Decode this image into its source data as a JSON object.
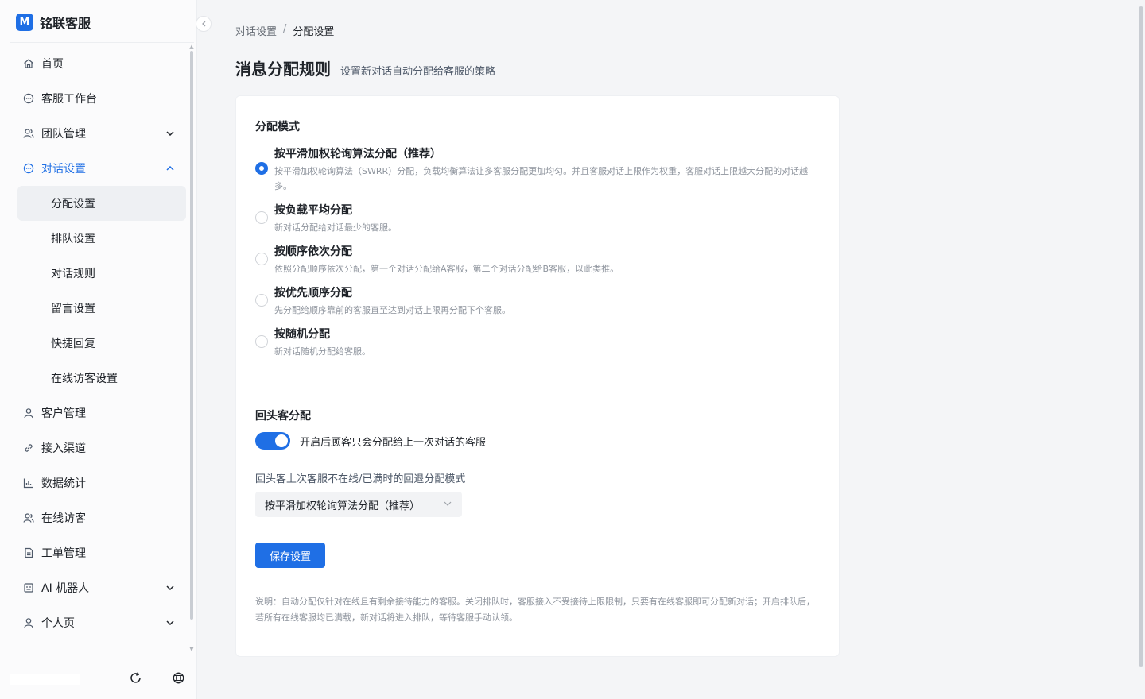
{
  "brand": {
    "logo_letter": "M",
    "name": "铭联客服"
  },
  "sidebar": {
    "items": [
      {
        "label": "首页",
        "icon": "home-icon"
      },
      {
        "label": "客服工作台",
        "icon": "chat-bubble-icon"
      },
      {
        "label": "团队管理",
        "icon": "team-icon",
        "has_children": true,
        "expanded": false
      },
      {
        "label": "对话设置",
        "icon": "chat-bubble-icon",
        "has_children": true,
        "expanded": true,
        "children": [
          "分配设置",
          "排队设置",
          "对话规则",
          "留言设置",
          "快捷回复",
          "在线访客设置"
        ],
        "active_child": "分配设置"
      },
      {
        "label": "客户管理",
        "icon": "user-icon"
      },
      {
        "label": "接入渠道",
        "icon": "link-icon"
      },
      {
        "label": "数据统计",
        "icon": "bar-chart-icon"
      },
      {
        "label": "在线访客",
        "icon": "visitors-icon"
      },
      {
        "label": "工单管理",
        "icon": "ticket-icon"
      },
      {
        "label": "AI 机器人",
        "icon": "robot-icon",
        "has_children": true,
        "expanded": false
      },
      {
        "label": "个人页",
        "icon": "user-icon",
        "has_children": true,
        "expanded": false
      }
    ]
  },
  "breadcrumb": {
    "parent": "对话设置",
    "separator": "/",
    "current": "分配设置"
  },
  "page": {
    "title": "消息分配规则",
    "subtitle": "设置新对话自动分配给客服的策略"
  },
  "assign_mode": {
    "section_title": "分配模式",
    "options": [
      {
        "title": "按平滑加权轮询算法分配（推荐）",
        "desc": "按平滑加权轮询算法（SWRR）分配，负载均衡算法让多客服分配更加均匀。并且客服对话上限作为权重，客服对话上限越大分配的对话越多。",
        "checked": true
      },
      {
        "title": "按负载平均分配",
        "desc": "新对话分配给对话最少的客服。",
        "checked": false
      },
      {
        "title": "按顺序依次分配",
        "desc": "依照分配顺序依次分配，第一个对话分配给A客服，第二个对话分配给B客服，以此类推。",
        "checked": false
      },
      {
        "title": "按优先顺序分配",
        "desc": "先分配给顺序靠前的客服直至达到对话上限再分配下个客服。",
        "checked": false
      },
      {
        "title": "按随机分配",
        "desc": "新对话随机分配给客服。",
        "checked": false
      }
    ]
  },
  "returning": {
    "section_title": "回头客分配",
    "toggle_on": true,
    "toggle_label": "开启后顾客只会分配给上一次对话的客服",
    "fallback_label": "回头客上次客服不在线/已满时的回退分配模式",
    "fallback_value": "按平滑加权轮询算法分配（推荐）"
  },
  "save_label": "保存设置",
  "note": "说明：自动分配仅针对在线且有剩余接待能力的客服。关闭排队时，客服接入不受接待上限限制，只要有在线客服即可分配新对话；开启排队后，若所有在线客服均已满载，新对话将进入排队，等待客服手动认领。",
  "colors": {
    "accent": "#1f6fe5"
  }
}
